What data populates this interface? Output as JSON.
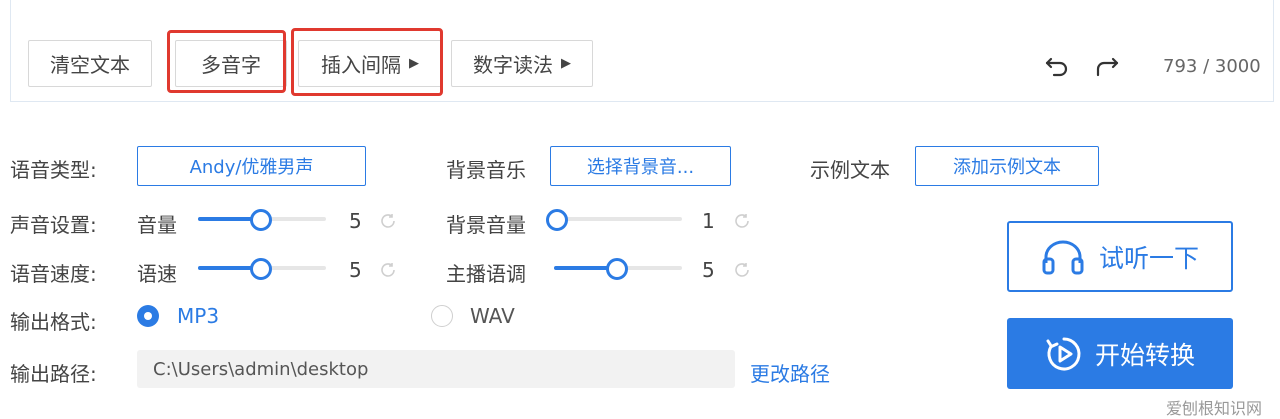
{
  "toolbar": {
    "clear_label": "清空文本",
    "polyphone_label": "多音字",
    "insert_pause_label": "插入间隔",
    "number_reading_label": "数字读法",
    "counter": "793 / 3000"
  },
  "settings": {
    "voice_type_label": "语音类型:",
    "voice_type_value": "Andy/优雅男声",
    "bg_music_label": "背景音乐",
    "bg_music_button": "选择背景音...",
    "sample_text_label": "示例文本",
    "sample_text_button": "添加示例文本",
    "sound_settings_label": "声音设置:",
    "volume_label": "音量",
    "volume_value": "5",
    "volume_fraction": 0.45,
    "bg_volume_label": "背景音量",
    "bg_volume_value": "1",
    "bg_volume_fraction": 0.0,
    "speed_section_label": "语音速度:",
    "speed_label": "语速",
    "speed_value": "5",
    "speed_fraction": 0.45,
    "pitch_label": "主播语调",
    "pitch_value": "5",
    "pitch_fraction": 0.45,
    "format_label": "输出格式:",
    "format_options": [
      "MP3",
      "WAV"
    ],
    "format_selected": "MP3",
    "path_label": "输出路径:",
    "path_value": "C:\\Users\\admin\\desktop",
    "change_path_label": "更改路径"
  },
  "actions": {
    "preview_label": "试听一下",
    "convert_label": "开始转换"
  },
  "watermark": "爱刨根知识网",
  "colors": {
    "accent": "#2b7be4",
    "highlight_box": "#e0392f"
  }
}
